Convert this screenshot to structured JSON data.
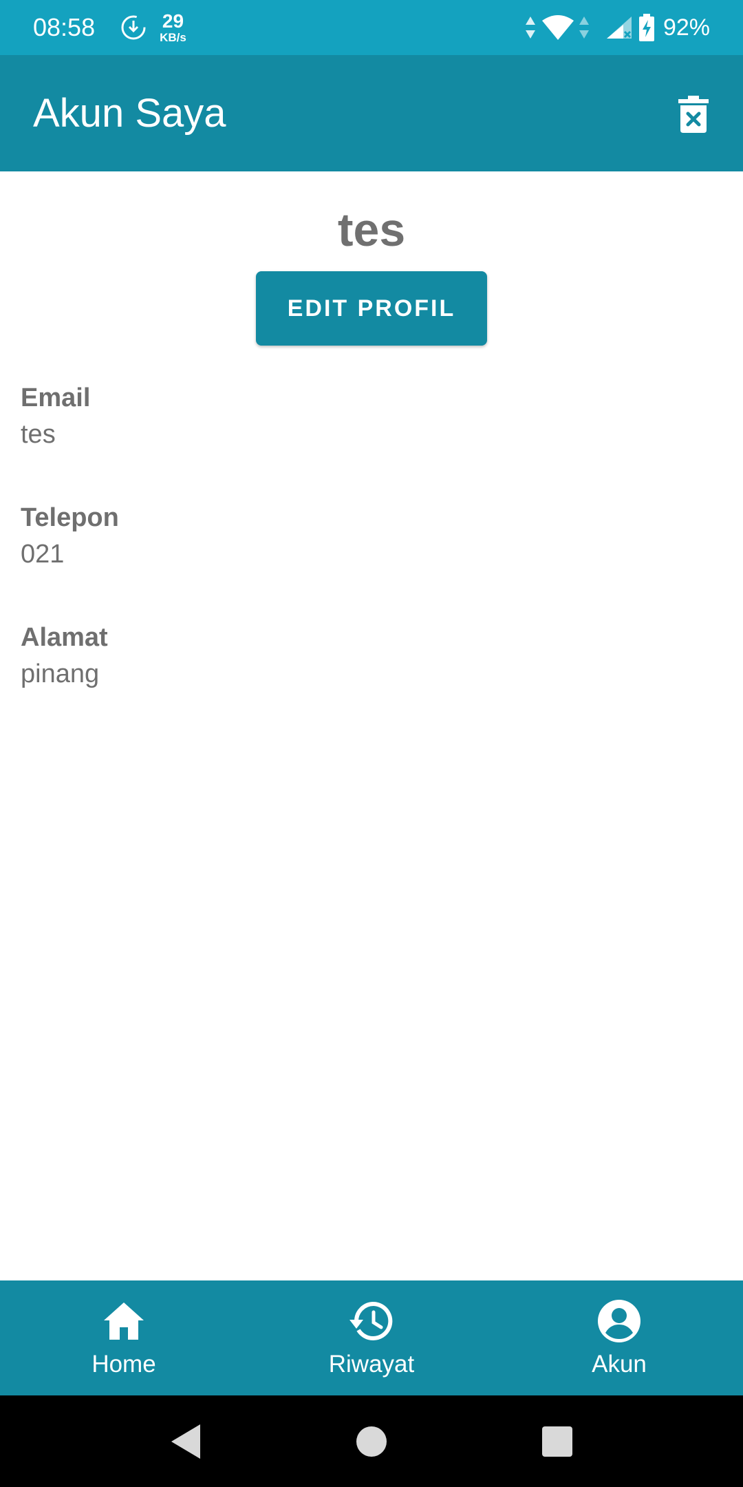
{
  "status_bar": {
    "time": "08:58",
    "net_speed_value": "29",
    "net_speed_unit": "KB/s",
    "battery_percent": "92%",
    "icons": [
      "download-clock-icon",
      "data-arrows-icon",
      "wifi-icon",
      "signal-icon",
      "battery-charging-icon"
    ]
  },
  "app_bar": {
    "title": "Akun Saya",
    "action_icon": "delete-account-icon"
  },
  "profile": {
    "name": "tes",
    "edit_label": "EDIT PROFIL",
    "fields": [
      {
        "label": "Email",
        "value": "tes"
      },
      {
        "label": "Telepon",
        "value": "021"
      },
      {
        "label": "Alamat",
        "value": "pinang"
      }
    ]
  },
  "bottom_nav": {
    "items": [
      {
        "label": "Home",
        "icon": "home-icon"
      },
      {
        "label": "Riwayat",
        "icon": "history-icon"
      },
      {
        "label": "Akun",
        "icon": "account-icon"
      }
    ]
  },
  "colors": {
    "status_bar": "#14a2bf",
    "primary": "#138aa2",
    "text_gray": "#707070"
  }
}
